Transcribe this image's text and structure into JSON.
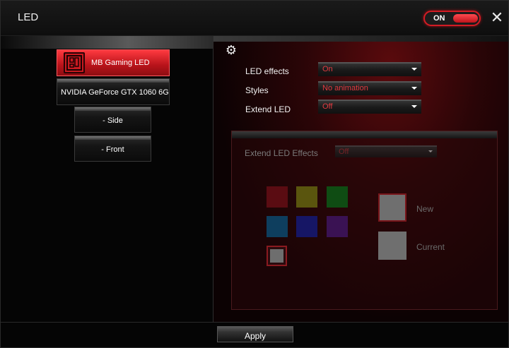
{
  "window": {
    "title": "LED"
  },
  "power": {
    "label": "ON"
  },
  "devices": {
    "mb": "MB Gaming LED",
    "gpu": "NVIDIA GeForce GTX 1060 6G",
    "side": "- Side",
    "front": "- Front"
  },
  "settings": {
    "led_effects_label": "LED effects",
    "led_effects_value": "On",
    "styles_label": "Styles",
    "styles_value": "No animation",
    "extend_led_label": "Extend LED",
    "extend_led_value": "Off"
  },
  "extend": {
    "effects_label": "Extend LED Effects",
    "effects_value": "Off",
    "new_label": "New",
    "current_label": "Current"
  },
  "colors": {
    "accent": "#d21c24",
    "swatches": [
      "#5a0c12",
      "#5a550e",
      "#0f4c13",
      "#0e3e5e",
      "#161665",
      "#3a1253"
    ]
  },
  "footer": {
    "apply_label": "Apply"
  }
}
